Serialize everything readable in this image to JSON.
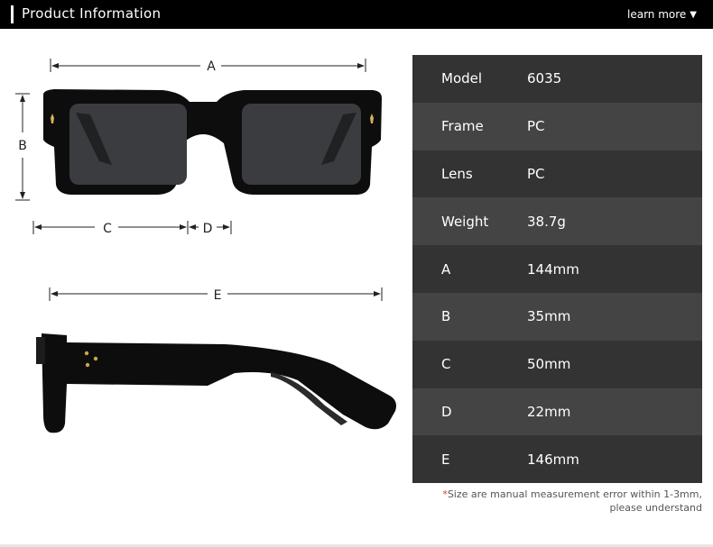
{
  "header": {
    "title": "Product Information",
    "learn_more": "learn more",
    "learn_more_icon": "triangle-down-icon",
    "learn_more_glyph": "▼"
  },
  "diagram": {
    "front_labels": {
      "a": "A",
      "b": "B",
      "c": "C",
      "d": "D"
    },
    "side_labels": {
      "e": "E"
    }
  },
  "specs": [
    {
      "key": "Model",
      "value": "6035"
    },
    {
      "key": "Frame",
      "value": "PC"
    },
    {
      "key": "Lens",
      "value": "PC"
    },
    {
      "key": "Weight",
      "value": "38.7g"
    },
    {
      "key": "A",
      "value": "144mm"
    },
    {
      "key": "B",
      "value": "35mm"
    },
    {
      "key": "C",
      "value": "50mm"
    },
    {
      "key": "D",
      "value": "22mm"
    },
    {
      "key": "E",
      "value": "146mm"
    }
  ],
  "note": {
    "star": "*",
    "line1": "Size are manual measurement error within 1-3mm,",
    "line2": "please understand"
  },
  "colors": {
    "header_bg": "#000000",
    "row_dark": "#333333",
    "row_light": "#444444",
    "note_star": "#e53935"
  }
}
